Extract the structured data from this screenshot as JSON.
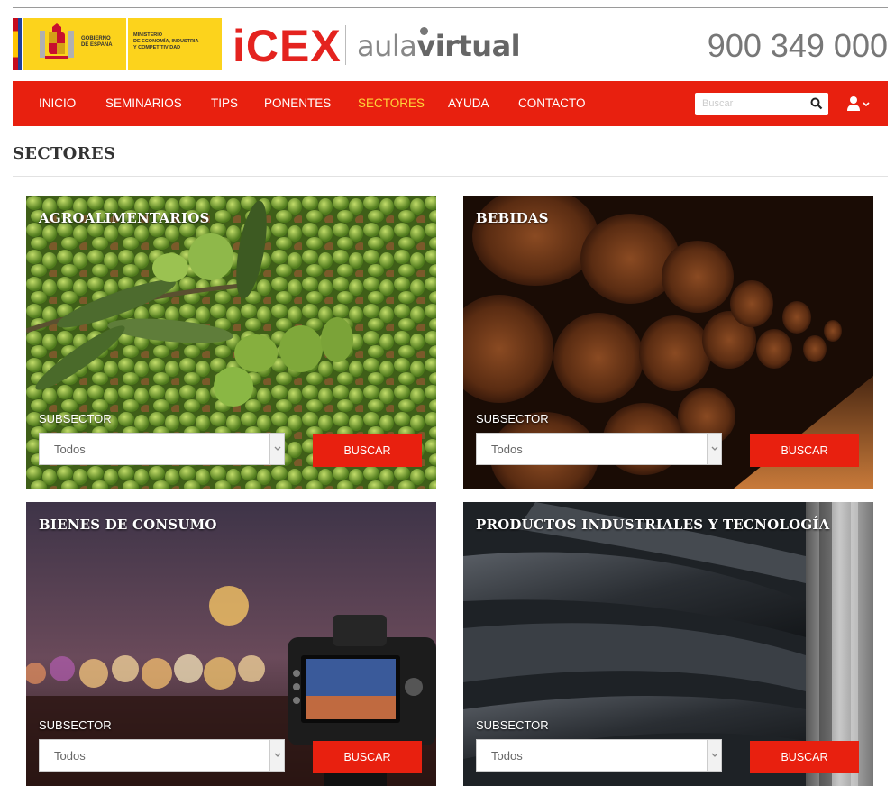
{
  "header": {
    "gov_lines": [
      "GOBIERNO",
      "DE ESPAÑA"
    ],
    "ministry_lines": [
      "MINISTERIO",
      "DE ECONOMÍA, INDUSTRIA",
      "Y COMPETITIVIDAD"
    ],
    "brand": "iCEX",
    "brand_sub_light": "aula",
    "brand_sub_bold": "virtual",
    "phone": "900 349 000"
  },
  "nav": {
    "items": [
      {
        "label": "INICIO"
      },
      {
        "label": "SEMINARIOS"
      },
      {
        "label": "TIPS"
      },
      {
        "label": "PONENTES"
      },
      {
        "label": "SECTORES",
        "active": true
      },
      {
        "label": "AYUDA"
      },
      {
        "label": "CONTACTO"
      }
    ],
    "search_placeholder": "Buscar"
  },
  "page": {
    "title": "SECTORES"
  },
  "sectors": [
    {
      "title": "AGROALIMENTARIOS",
      "subsector_label": "SUBSECTOR",
      "select_value": "Todos",
      "button": "BUSCAR"
    },
    {
      "title": "BEBIDAS",
      "subsector_label": "SUBSECTOR",
      "select_value": "Todos",
      "button": "BUSCAR"
    },
    {
      "title": "BIENES DE CONSUMO",
      "subsector_label": "SUBSECTOR",
      "select_value": "Todos",
      "button": "BUSCAR"
    },
    {
      "title": "PRODUCTOS INDUSTRIALES Y TECNOLOGÍA",
      "subsector_label": "SUBSECTOR",
      "select_value": "Todos",
      "button": "BUSCAR"
    }
  ],
  "colors": {
    "brand_red": "#e8200f",
    "nav_active": "#ffd43a",
    "phone": "#777777"
  }
}
